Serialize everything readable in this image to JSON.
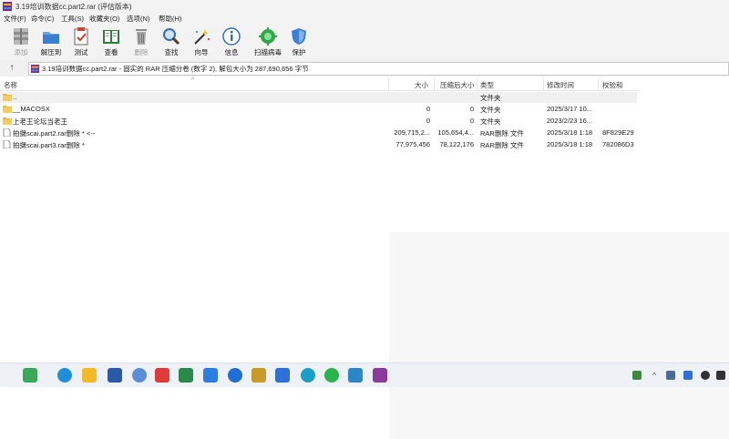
{
  "window": {
    "title": "3.19培训数据cc.part2.rar (评估版本)"
  },
  "menu": [
    "文件(F)",
    "命令(C)",
    "工具(S)",
    "收藏夹(O)",
    "选项(N)",
    "帮助(H)"
  ],
  "toolbar": [
    {
      "label": "添加",
      "icon": "add-archive-icon",
      "disabled": true
    },
    {
      "label": "解压到",
      "icon": "extract-to-icon",
      "disabled": false
    },
    {
      "label": "测试",
      "icon": "test-icon",
      "disabled": false
    },
    {
      "label": "查看",
      "icon": "view-book-icon",
      "disabled": false
    },
    {
      "label": "删除",
      "icon": "delete-trash-icon",
      "disabled": true
    },
    {
      "label": "查找",
      "icon": "find-magnifier-icon",
      "disabled": false
    },
    {
      "label": "向导",
      "icon": "wizard-wand-icon",
      "disabled": false
    },
    {
      "label": "信息",
      "icon": "info-icon",
      "disabled": false
    },
    {
      "label": "扫描病毒",
      "icon": "virus-scan-icon",
      "disabled": false
    },
    {
      "label": "保护",
      "icon": "protect-shield-icon",
      "disabled": false
    }
  ],
  "address": {
    "up_symbol": "↑",
    "path": "3.19培训数据cc.part2.rar - 固实的 RAR 压缩分卷 (数字 2), 解包大小为 287,690,656 字节"
  },
  "columns": [
    "名称",
    "大小",
    "压缩后大小",
    "类型",
    "修改时间",
    "校验和"
  ],
  "sort_indicator": "^",
  "rows": [
    {
      "name": "..",
      "size": "",
      "packed": "",
      "type": "文件夹",
      "modified": "",
      "crc": "",
      "icon": "folder-icon"
    },
    {
      "name": "__MACOSX",
      "size": "0",
      "packed": "0",
      "type": "文件夹",
      "modified": "2025/3/17 10...",
      "crc": "",
      "icon": "folder-icon"
    },
    {
      "name": "上老王论坛当老王",
      "size": "0",
      "packed": "0",
      "type": "文件夹",
      "modified": "2023/2/23 16...",
      "crc": "",
      "icon": "folder-icon"
    },
    {
      "name": "拍摄scai.part2.rar删除 * <--",
      "size": "209,715,2...",
      "packed": "105,654,4...",
      "type": "RAR删除 文件",
      "modified": "2025/3/18 1:18",
      "crc": "8F829E29",
      "icon": "file-icon"
    },
    {
      "name": "拍摄scai.part3.rar删除 *",
      "size": "77,975,456",
      "packed": "78,122,176",
      "type": "RAR删除 文件",
      "modified": "2025/3/18 1:18",
      "crc": "782086D3",
      "icon": "file-icon"
    }
  ],
  "taskbar": {
    "apps": [
      {
        "icon": "recycle-bin-icon",
        "color": "#3aa85a"
      },
      {
        "icon": "edge-browser-icon",
        "color": "#1f8fd8"
      },
      {
        "icon": "file-explorer-icon",
        "color": "#f2b928"
      },
      {
        "icon": "powershell-icon",
        "color": "#2b5aa8"
      },
      {
        "icon": "network-app-icon",
        "color": "#5a8fd8"
      },
      {
        "icon": "wps-office-icon",
        "color": "#e03a3a"
      },
      {
        "icon": "media-player-icon",
        "color": "#2b8a4a"
      },
      {
        "icon": "feishu-icon",
        "color": "#2a7de1"
      },
      {
        "icon": "chat-app-icon",
        "color": "#1e6fd8"
      },
      {
        "icon": "mascot-app-icon",
        "color": "#c79a2a"
      },
      {
        "icon": "shield-app-icon",
        "color": "#2f6fd8"
      },
      {
        "icon": "browser-app-icon",
        "color": "#1aa0c8"
      },
      {
        "icon": "wechat-icon",
        "color": "#2ab54a"
      },
      {
        "icon": "notepad-icon",
        "color": "#2a88c8"
      },
      {
        "icon": "winrar-icon",
        "color": "#8a3a9a"
      }
    ],
    "tray": [
      {
        "icon": "tray-app-icon",
        "color": "#3a8a3a"
      },
      {
        "icon": "chevron-up-icon",
        "color": "#555555"
      },
      {
        "icon": "network-tray-icon",
        "color": "#4a6a9a"
      },
      {
        "icon": "security-tray-icon",
        "color": "#2f6fd8"
      },
      {
        "icon": "wifi-icon",
        "color": "#333333"
      },
      {
        "icon": "volume-icon",
        "color": "#333333"
      }
    ]
  }
}
